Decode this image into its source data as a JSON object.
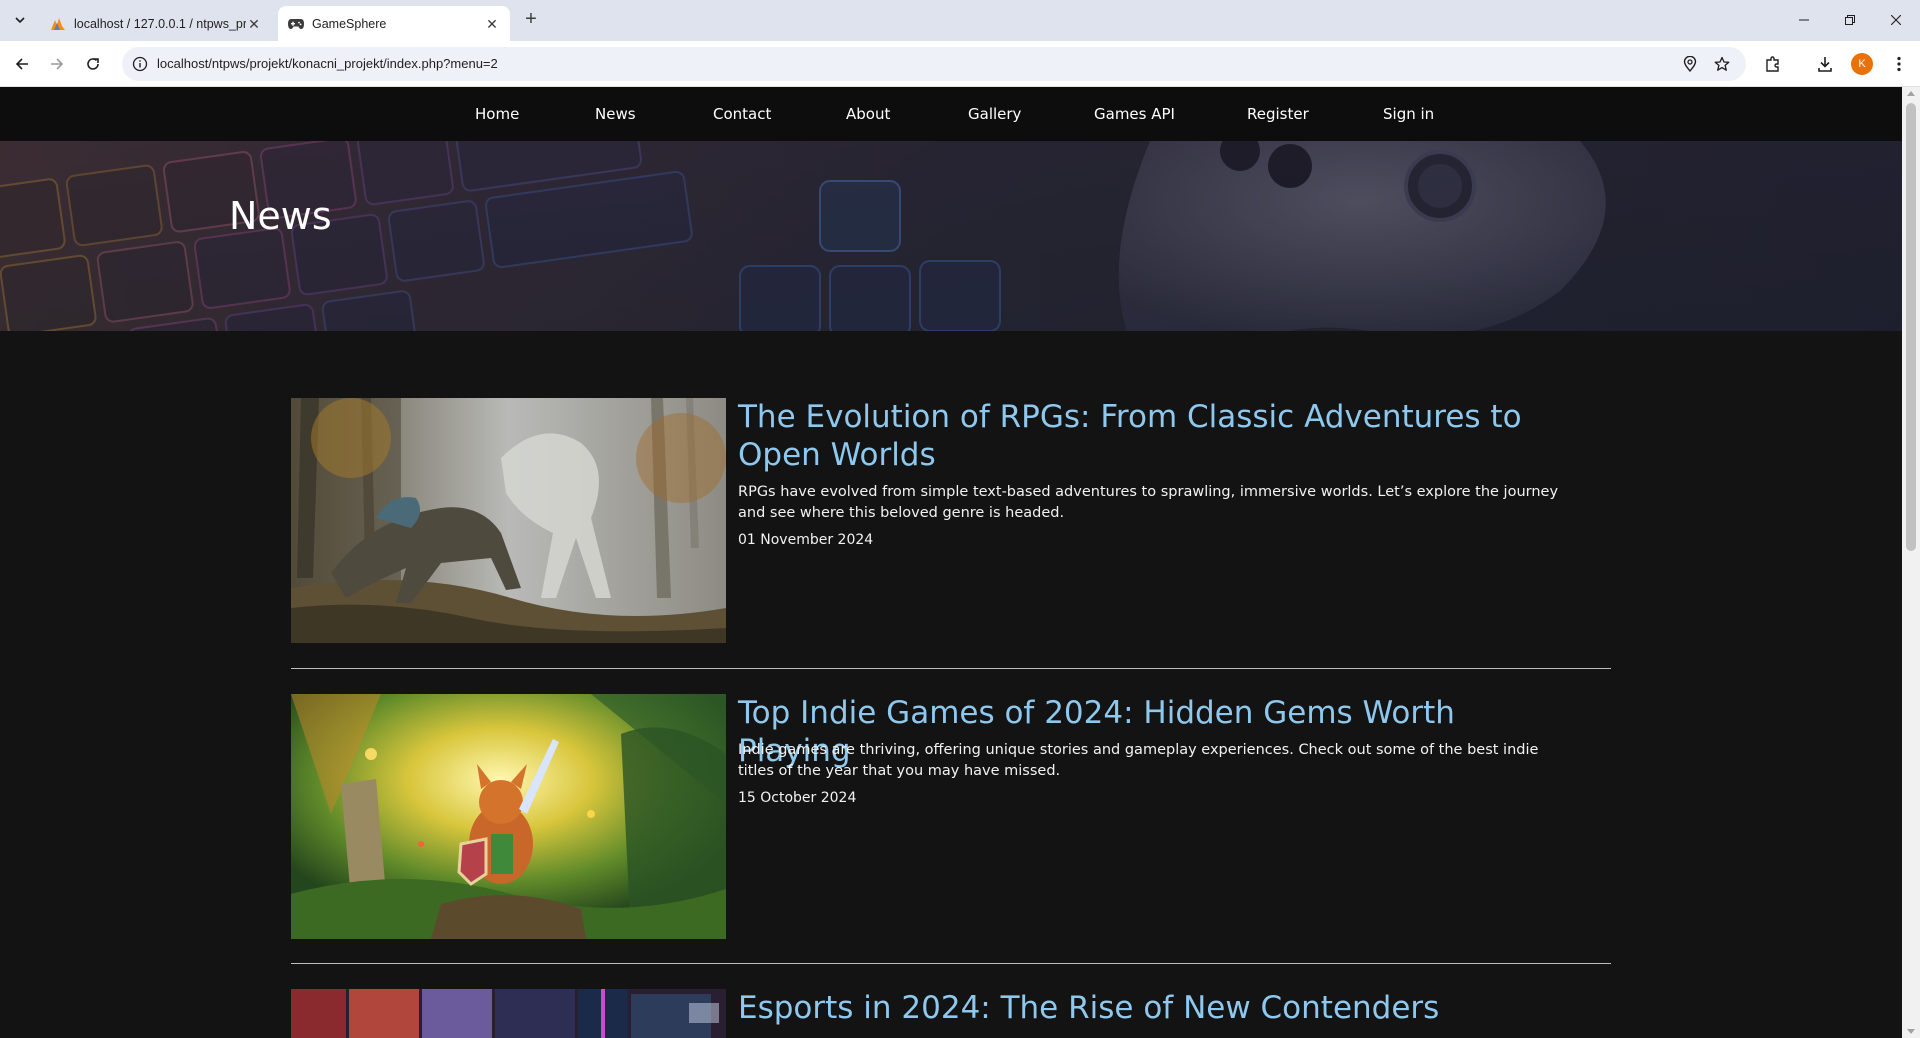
{
  "browser": {
    "tabs": [
      {
        "title": "localhost / 127.0.0.1 / ntpws_pr"
      },
      {
        "title": "GameSphere"
      }
    ],
    "url": "localhost/ntpws/projekt/konacni_projekt/index.php?menu=2",
    "profile_initial": "K"
  },
  "nav": {
    "items": [
      "Home",
      "News",
      "Contact",
      "About",
      "Gallery",
      "Games API",
      "Register",
      "Sign in"
    ]
  },
  "hero": {
    "title": "News"
  },
  "articles": [
    {
      "title": "The Evolution of RPGs: From Classic Adventures to Open Worlds",
      "description": "RPGs have evolved from simple text-based adventures to sprawling, immersive worlds. Let’s explore the journey and see where this beloved genre is headed.",
      "date": "01 November 2024"
    },
    {
      "title": "Top Indie Games of 2024: Hidden Gems Worth Playing",
      "description": "Indie games are thriving, offering unique stories and gameplay experiences. Check out some of the best indie titles of the year that you may have missed.",
      "date": "15 October 2024"
    },
    {
      "title": "Esports in 2024: The Rise of New Contenders"
    }
  ],
  "colors": {
    "page_bg": "#131313",
    "nav_bg": "#0d0d0d",
    "article_title": "#8ec8ee",
    "profile": "#e8710a"
  }
}
